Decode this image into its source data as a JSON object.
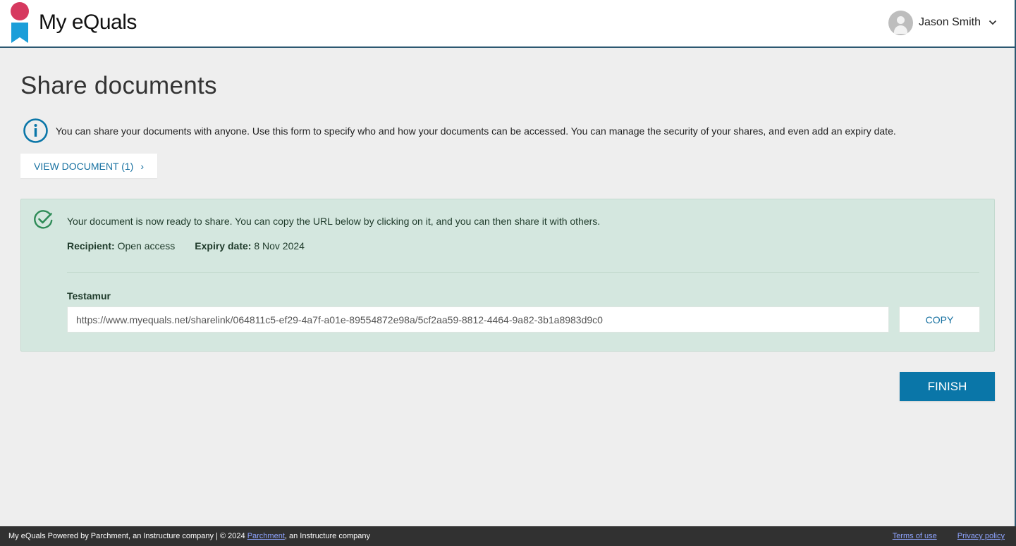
{
  "app": {
    "brand_name": "My eQuals",
    "logo_colors": {
      "dot": "#d6395f",
      "flag": "#1b9ed9"
    }
  },
  "user": {
    "name": "Jason Smith",
    "avatar_icon": "user-avatar-icon",
    "menu_icon": "chevron-down-icon"
  },
  "page": {
    "title": "Share documents",
    "info_text": "You can share your documents with anyone. Use this form to specify who and how your documents can be accessed. You can manage the security of your shares, and even add an expiry date.",
    "view_document_label": "VIEW DOCUMENT (1)",
    "view_document_arrow": "›"
  },
  "share_result": {
    "message": "Your document is now ready to share. You can copy the URL below by clicking on it, and you can then share it with others.",
    "recipient_label": "Recipient:",
    "recipient_value": "Open access",
    "expiry_label": "Expiry date:",
    "expiry_value": "8 Nov 2024",
    "document_name": "Testamur",
    "share_url": "https://www.myequals.net/sharelink/064811c5-ef29-4a7f-a01e-89554872e98a/5cf2aa59-8812-4464-9a82-3b1a8983d9c0",
    "copy_label": "COPY"
  },
  "actions": {
    "finish_label": "FINISH"
  },
  "footer": {
    "text_prefix": "My eQuals Powered by Parchment, an Instructure company | © 2024 ",
    "parchment_link": "Parchment",
    "text_suffix": ", an Instructure company",
    "terms_label": "Terms of use",
    "privacy_label": "Privacy policy"
  },
  "colors": {
    "accent": "#0a76a8",
    "success_bg": "#d4e7df",
    "header_border": "#2c5871",
    "footer_bg": "#313131"
  }
}
